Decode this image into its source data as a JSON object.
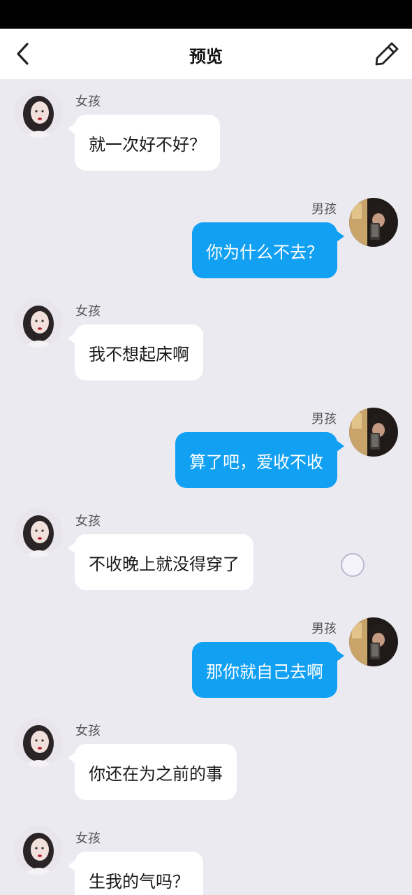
{
  "header": {
    "title": "预览",
    "back_icon": "chevron-left-icon",
    "edit_icon": "pencil-icon"
  },
  "colors": {
    "accent": "#12a0f3",
    "background": "#eceaf1",
    "left_bubble": "#ffffff"
  },
  "contacts": {
    "girl": "女孩",
    "boy": "男孩"
  },
  "messages": [
    {
      "side": "left",
      "name": "女孩",
      "text": "就一次好不好？"
    },
    {
      "side": "right",
      "name": "男孩",
      "text": "你为什么不去？"
    },
    {
      "side": "left",
      "name": "女孩",
      "text": "我不想起床啊"
    },
    {
      "side": "right",
      "name": "男孩",
      "text": "算了吧，爱收不收"
    },
    {
      "side": "left",
      "name": "女孩",
      "text": "不收晚上就没得穿了"
    },
    {
      "side": "right",
      "name": "男孩",
      "text": "那你就自己去啊"
    },
    {
      "side": "left",
      "name": "女孩",
      "text": "你还在为之前的事"
    },
    {
      "side": "left",
      "name": "女孩",
      "text": "生我的气吗？"
    }
  ]
}
